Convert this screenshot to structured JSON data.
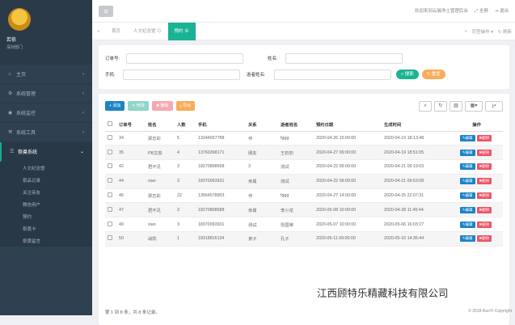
{
  "sidebar": {
    "user": {
      "name": "若依",
      "role": "深圳部门"
    },
    "menu": [
      {
        "icon": "⌂",
        "label": "主页",
        "arrow": "‹"
      },
      {
        "icon": "⚙",
        "label": "系统管理",
        "arrow": "‹"
      },
      {
        "icon": "◉",
        "label": "系统监控",
        "arrow": "‹"
      },
      {
        "icon": "⚒",
        "label": "系统工具",
        "arrow": "‹"
      },
      {
        "icon": "☰",
        "label": "祭奠系统",
        "arrow": "⌄",
        "active": true
      }
    ],
    "submenu": [
      "人文纪念馆",
      "祭品记录",
      "关注亲友",
      "微信用户",
      "预约",
      "祭奠卡",
      "祭奠留言"
    ]
  },
  "topbar": {
    "menu_icon": "≡",
    "links": [
      "欢迎来到云端净土管理后台",
      "全屏",
      "退出"
    ]
  },
  "tabs": {
    "nav_prev": "«",
    "nav_next": "»",
    "items": [
      {
        "label": "首页",
        "active": false
      },
      {
        "label": "人文纪念馆 ⊙",
        "active": false
      },
      {
        "label": "预约 ⊗",
        "active": true
      }
    ],
    "right": [
      "页签操作 ▾",
      "刷新"
    ]
  },
  "search": {
    "order_label": "订单号:",
    "name_label": "姓名:",
    "phone_label": "手机:",
    "deceased_label": "逝者姓名:",
    "search_btn": "搜索",
    "reset_btn": "重置"
  },
  "toolbar": {
    "add": "添加",
    "edit": "修改",
    "delete": "删除",
    "export": "导出",
    "icons": [
      "search-icon",
      "refresh-icon",
      "columns-icon",
      "grid-icon",
      "export-icon"
    ]
  },
  "table": {
    "headers": [
      "订单号",
      "姓名",
      "人数",
      "手机",
      "关系",
      "逝者姓名",
      "预约日期",
      "生成时间",
      "操作"
    ],
    "rows": [
      [
        "34",
        "梁志彩",
        "5",
        "13244557788",
        "伴",
        "fggg",
        "2020-04-26 15:00:00",
        "2020-04-19 18:13:48"
      ],
      [
        "35",
        "PB文茄",
        "4",
        "13760398171",
        "朋友",
        "王奶奶",
        "2020-04-27 09:00:00",
        "2020-04-19 18:51:05"
      ],
      [
        "42",
        "君不见",
        "3",
        "18270898658",
        "3",
        "测试",
        "2020-04-22 09:00:00",
        "2020-04-21 09:19:03"
      ],
      [
        "44",
        "xian",
        "3",
        "18370093931",
        "亲属",
        "测试",
        "2020-04-22 09:00:00",
        "2020-04-21 09:53:08"
      ],
      [
        "46",
        "梁志彩",
        "22",
        "13564578903",
        "伴",
        "fggg",
        "2020-04-27 14:00:00",
        "2020-04-25 22:07:31"
      ],
      [
        "47",
        "君不见",
        "3",
        "18270898588",
        "亲属",
        "李小龙",
        "2020-05-08 10:00:00",
        "2020-04-28 11:45:44"
      ],
      [
        "49",
        "xian",
        "3",
        "18370093931",
        "测试",
        "张国荣",
        "2020-05-07 10:00:00",
        "2020-05-06 16:03:27"
      ],
      [
        "50",
        "战凯",
        "1",
        "18318816134",
        "弟子",
        "孔子",
        "2020-05-11 09:00:00",
        "2020-05-10 14:35:44"
      ]
    ],
    "edit_btn": "编辑",
    "delete_btn": "删除"
  },
  "pager": "第 1 到 8 条，共 8 条记录。",
  "watermark": "江西顾特乐精藏科技有限公司",
  "footer": "© 2018 RuoYi Copyright",
  "colors": {
    "sidebar": "#2f4050",
    "primary": "#1ab394",
    "add": "#1c84c6",
    "danger": "#ed5565",
    "warning": "#f8ac59",
    "edit": "#1c84c6"
  }
}
